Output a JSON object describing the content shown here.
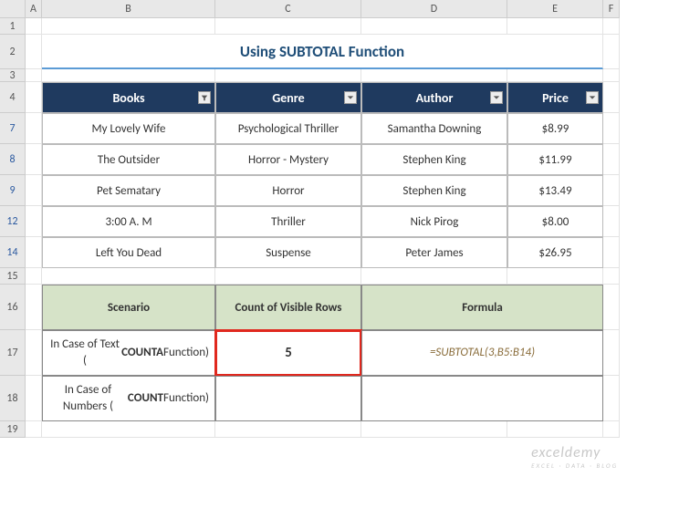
{
  "cols": [
    "",
    "A",
    "B",
    "C",
    "D",
    "E",
    "F"
  ],
  "visible_rows": [
    "1",
    "2",
    "3",
    "4",
    "7",
    "8",
    "9",
    "12",
    "14",
    "15",
    "16",
    "17",
    "18",
    "19"
  ],
  "filtered_rows": [
    "7",
    "8",
    "9",
    "12",
    "14"
  ],
  "title": "Using SUBTOTAL Function",
  "headers": {
    "books": "Books",
    "genre": "Genre",
    "author": "Author",
    "price": "Price"
  },
  "data": [
    {
      "book": "My Lovely Wife",
      "genre": "Psychological Thriller",
      "author": "Samantha Downing",
      "price": "$8.99"
    },
    {
      "book": "The Outsider",
      "genre": "Horror - Mystery",
      "author": "Stephen King",
      "price": "$11.99"
    },
    {
      "book": "Pet Sematary",
      "genre": "Horror",
      "author": "Stephen King",
      "price": "$13.49"
    },
    {
      "book": "3:00 A. M",
      "genre": "Thriller",
      "author": "Nick Pirog",
      "price": "$8.00"
    },
    {
      "book": "Left You Dead",
      "genre": "Suspense",
      "author": "Peter James",
      "price": "$26.95"
    }
  ],
  "scenario_headers": {
    "scenario": "Scenario",
    "count": "Count of Visible Rows",
    "formula": "Formula"
  },
  "scenarios": [
    {
      "label_pre": "In Case of Text (",
      "label_bold": "COUNTA",
      "label_post": " Function)",
      "count": "5",
      "formula": "=SUBTOTAL(3,B5:B14)"
    },
    {
      "label_pre": "In Case of Numbers (",
      "label_bold": "COUNT",
      "label_post": " Function)",
      "count": "",
      "formula": ""
    }
  ],
  "watermark": "exceldemy",
  "watermark_sub": "EXCEL · DATA · BLOG"
}
